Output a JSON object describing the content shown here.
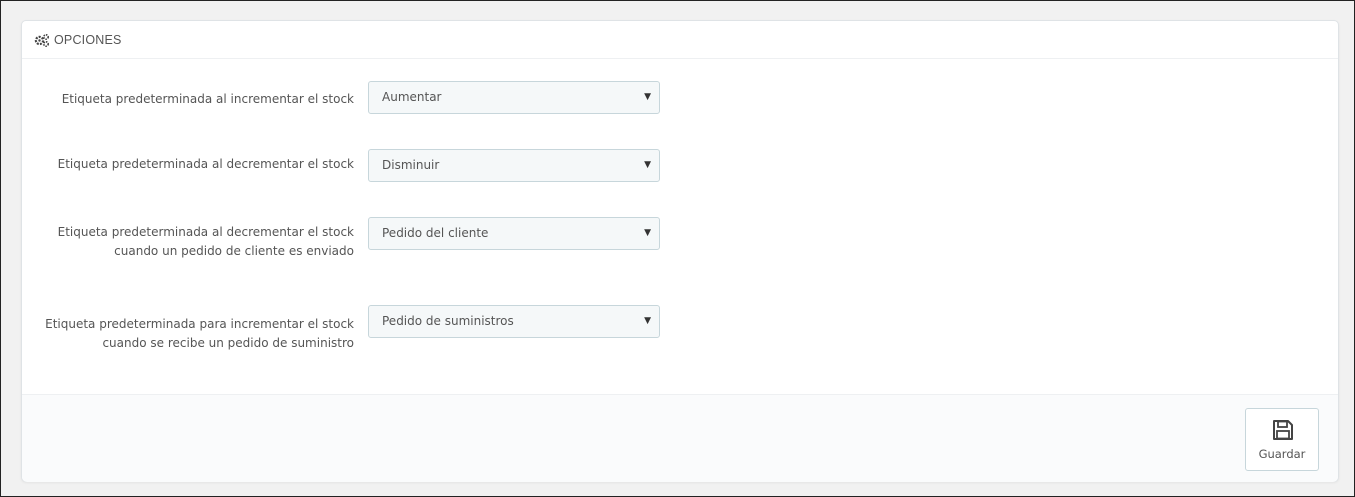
{
  "panel": {
    "title": "OPCIONES"
  },
  "options": [
    {
      "label": "Etiqueta predeterminada al incrementar el stock",
      "value": "Aumentar"
    },
    {
      "label": "Etiqueta predeterminada al decrementar el stock",
      "value": "Disminuir"
    },
    {
      "label": "Etiqueta predeterminada al decrementar el stock cuando un pedido de cliente es enviado",
      "value": "Pedido del cliente"
    },
    {
      "label": "Etiqueta predeterminada para incrementar el stock cuando se recibe un pedido de suministro",
      "value": "Pedido de suministros"
    }
  ],
  "footer": {
    "save_label": "Guardar"
  },
  "icons": {
    "heading": "cogs-icon",
    "select_caret": "caret-down-icon",
    "save": "floppy-disk-icon"
  }
}
